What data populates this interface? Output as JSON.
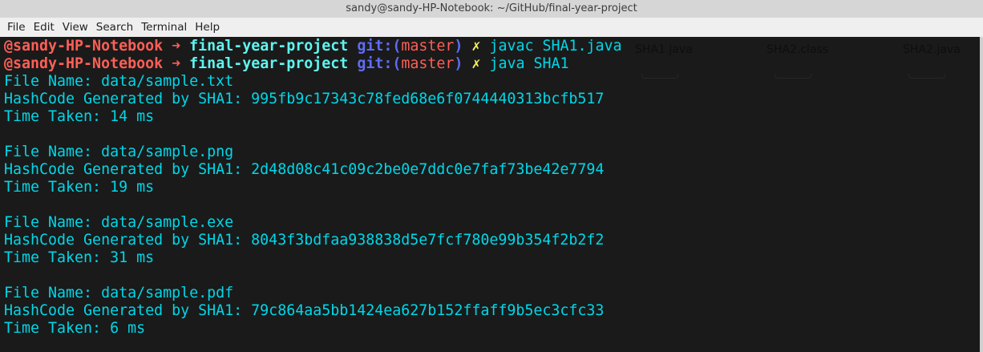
{
  "window": {
    "title": "sandy@sandy-HP-Notebook: ~/GitHub/final-year-project"
  },
  "menu": [
    "File",
    "Edit",
    "View",
    "Search",
    "Terminal",
    "Help"
  ],
  "desktop_files": [
    "SHA1.java",
    "SHA2.class",
    "SHA2.java"
  ],
  "prompt": {
    "user": "@sandy-HP-Notebook",
    "arrow": "➜",
    "dir": "final-year-project",
    "git_open": "git:(",
    "branch": "master",
    "git_close": ")",
    "dirty": "✗"
  },
  "commands": [
    "javac SHA1.java",
    "java SHA1"
  ],
  "results": [
    {
      "file": "File Name: data/sample.txt",
      "hash": "HashCode Generated by SHA1: 995fb9c17343c78fed68e6f0744440313bcfb517",
      "time": "Time Taken: 14 ms"
    },
    {
      "file": "File Name: data/sample.png",
      "hash": "HashCode Generated by SHA1: 2d48d08c41c09c2be0e7ddc0e7faf73be42e7794",
      "time": "Time Taken: 19 ms"
    },
    {
      "file": "File Name: data/sample.exe",
      "hash": "HashCode Generated by SHA1: 8043f3bdfaa938838d5e7fcf780e99b354f2b2f2",
      "time": "Time Taken: 31 ms"
    },
    {
      "file": "File Name: data/sample.pdf",
      "hash": "HashCode Generated by SHA1: 79c864aa5bb1424ea627b152ffaff9b5ec3cfc33",
      "time": "Time Taken: 6 ms"
    }
  ]
}
